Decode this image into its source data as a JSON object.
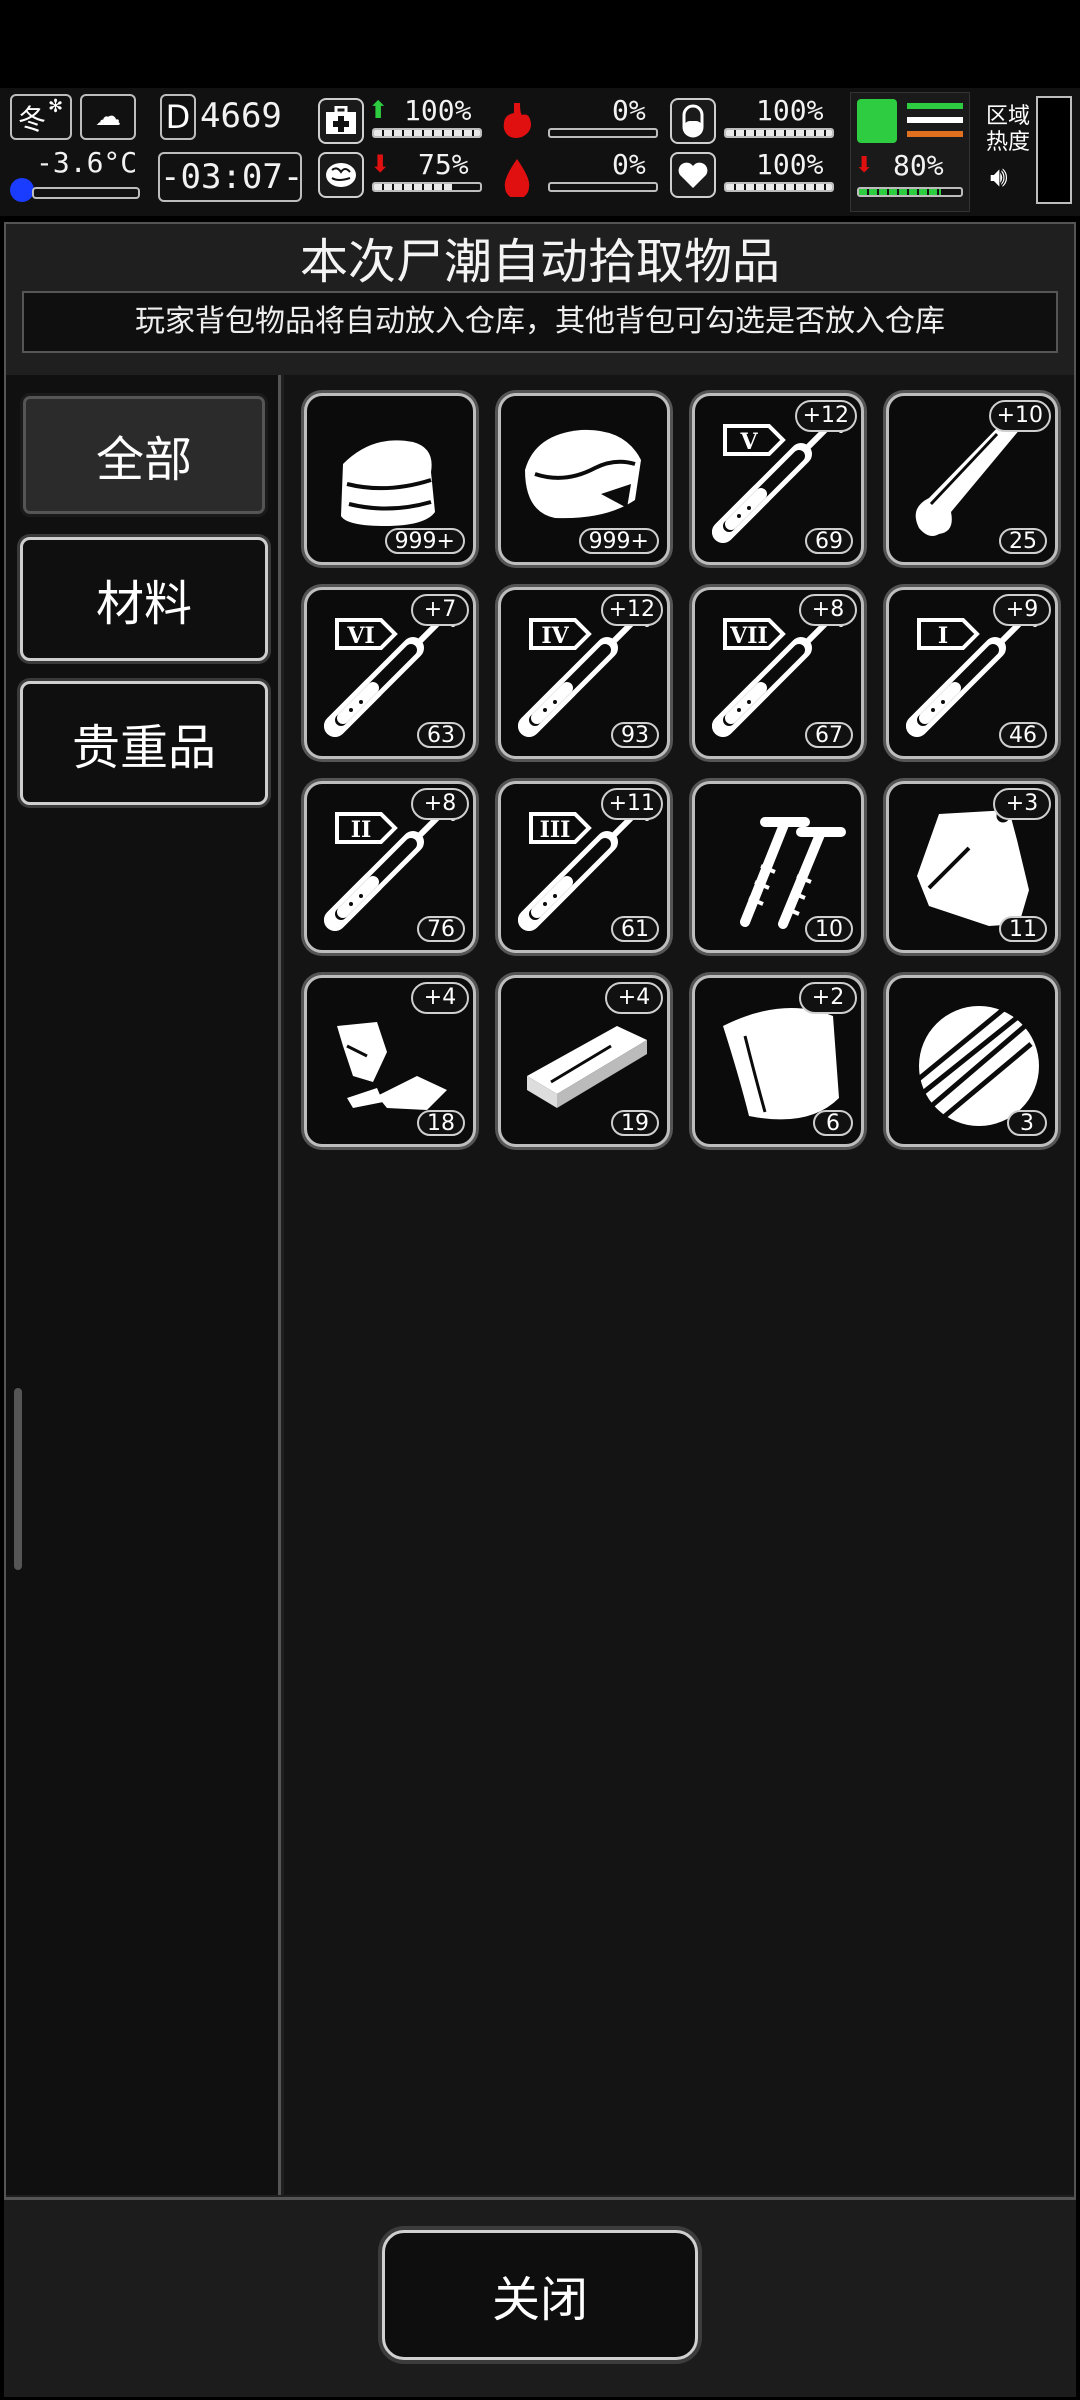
{
  "hud": {
    "season": "冬",
    "temperature": "-3.6°C",
    "day_counter": "4669",
    "day_prefix": "D",
    "clock": "-03:07-",
    "health_pct": "100%",
    "stomach_pct": "0%",
    "pill_pct": "100%",
    "brain_pct": "75%",
    "blood_pct": "0%",
    "heart_pct": "100%",
    "stamina_pct": "80%",
    "zone_heat_label_1": "区域",
    "zone_heat_label_2": "热度",
    "bars": {
      "health": 1.0,
      "stomach": 0.0,
      "pill": 1.0,
      "brain": 0.75,
      "blood": 0.0,
      "heart": 1.0,
      "stamina": 0.8
    }
  },
  "dialog": {
    "title": "本次尸潮自动拾取物品",
    "subtitle": "玩家背包物品将自动放入仓库，其他背包可勾选是否放入仓库",
    "tabs": [
      "全部",
      "材料",
      "贵重品"
    ],
    "close_label": "关闭"
  },
  "items": [
    {
      "icon": "cloth-icon",
      "count": "999+",
      "bonus": ""
    },
    {
      "icon": "meat-icon",
      "count": "999+",
      "bonus": ""
    },
    {
      "icon": "syringe-v-icon",
      "roman": "V",
      "count": "69",
      "bonus": "+12"
    },
    {
      "icon": "bone-icon",
      "count": "25",
      "bonus": "+10"
    },
    {
      "icon": "syringe-vi-icon",
      "roman": "VI",
      "count": "63",
      "bonus": "+7"
    },
    {
      "icon": "syringe-iv-icon",
      "roman": "IV",
      "count": "93",
      "bonus": "+12"
    },
    {
      "icon": "syringe-vii-icon",
      "roman": "VII",
      "count": "67",
      "bonus": "+8"
    },
    {
      "icon": "syringe-i-icon",
      "roman": "I",
      "count": "46",
      "bonus": "+9"
    },
    {
      "icon": "syringe-ii-icon",
      "roman": "II",
      "count": "76",
      "bonus": "+8"
    },
    {
      "icon": "syringe-iii-icon",
      "roman": "III",
      "count": "61",
      "bonus": "+11"
    },
    {
      "icon": "screws-icon",
      "count": "10",
      "bonus": ""
    },
    {
      "icon": "bag-icon",
      "count": "11",
      "bonus": "+3"
    },
    {
      "icon": "scrap-icon",
      "count": "18",
      "bonus": "+4"
    },
    {
      "icon": "plank-icon",
      "count": "19",
      "bonus": "+4"
    },
    {
      "icon": "leather-icon",
      "count": "6",
      "bonus": "+2"
    },
    {
      "icon": "wood-bundle-icon",
      "count": "3",
      "bonus": ""
    }
  ]
}
